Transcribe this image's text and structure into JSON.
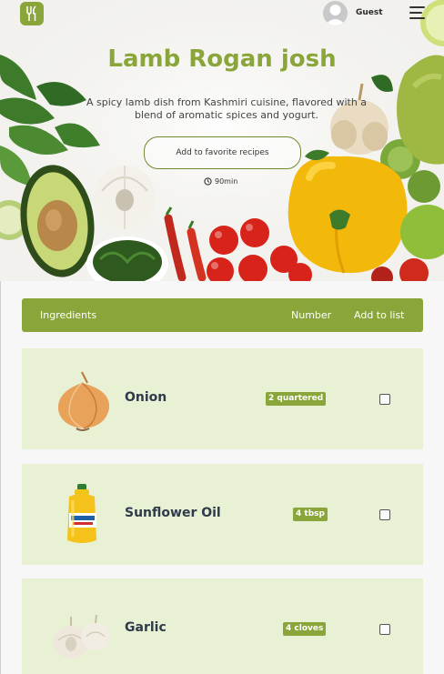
{
  "header": {
    "user_label": "Guest"
  },
  "recipe": {
    "title": "Lamb Rogan josh",
    "description": "A spicy lamb dish from Kashmiri cuisine, flavored with a blend of aromatic spices and yogurt.",
    "favorite_button_label": "Add to favorite recipes",
    "time": "90min"
  },
  "ingredients_table": {
    "headers": {
      "ingredients": "Ingredients",
      "number": "Number",
      "add_to_list": "Add to list"
    },
    "rows": [
      {
        "name": "Onion",
        "quantity": "2 quartered",
        "checked": false,
        "image": "onion"
      },
      {
        "name": "Sunflower Oil",
        "quantity": "4 tbsp",
        "checked": false,
        "image": "oil-bottle"
      },
      {
        "name": "Garlic",
        "quantity": "4 cloves",
        "checked": false,
        "image": "garlic"
      }
    ]
  },
  "colors": {
    "accent": "#8aa63a",
    "row_background": "#e9f1d5",
    "text_dark": "#2f3a4a"
  }
}
